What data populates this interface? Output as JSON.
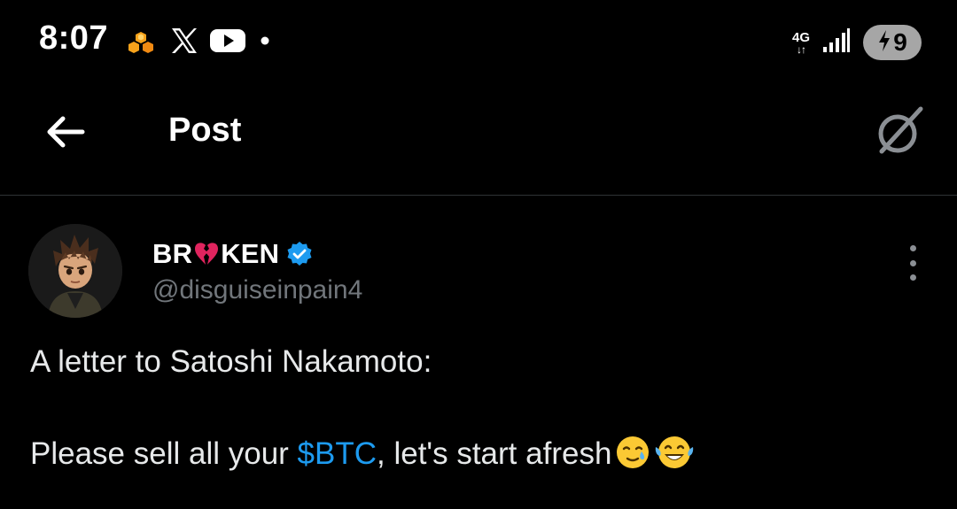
{
  "status_bar": {
    "time": "8:07",
    "network_type": "4G",
    "network_arrows": "↓↑",
    "battery_level": "9",
    "notification_icons": [
      "honeycomb-icon",
      "x-logo-icon",
      "youtube-icon",
      "more-notifications-dot"
    ]
  },
  "header": {
    "title": "Post",
    "back_icon": "arrow-left-icon",
    "grok_icon": "grok-icon"
  },
  "post": {
    "author": {
      "name_before": "BR",
      "name_emoji": "broken-heart-icon",
      "name_after": "KEN",
      "verified": true,
      "handle": "@disguiseinpain4"
    },
    "line1": "A letter to Satoshi Nakamoto:",
    "line2_before": "Please sell all your ",
    "cashtag": "$BTC",
    "line2_after": ", let's start afresh",
    "emojis": [
      "smiling-face-with-tear-icon",
      "tears-of-joy-icon"
    ]
  },
  "colors": {
    "background": "#000000",
    "text": "#e7e9ea",
    "secondary_text": "#71767b",
    "accent": "#1d9bf0",
    "divider": "#2f3336",
    "verified": "#1d9bf0",
    "broken_heart": "#e0245e"
  }
}
